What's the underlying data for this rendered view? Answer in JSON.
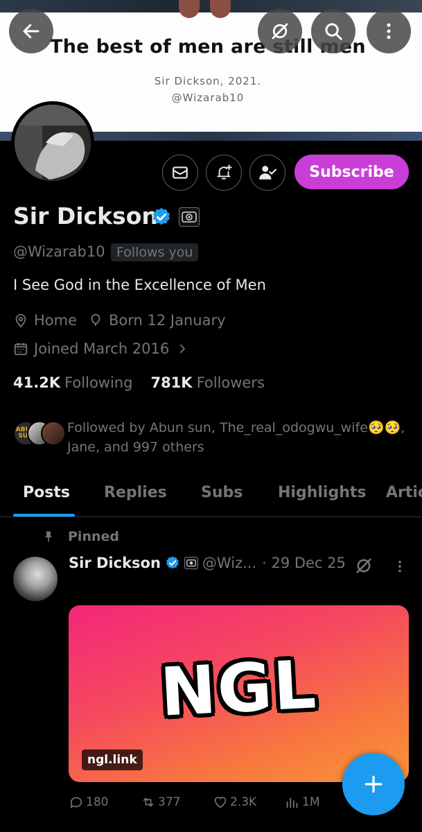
{
  "banner": {
    "quote": "The best of men are still men",
    "signature_line1": "Sir Dickson, 2021.",
    "signature_line2": "@Wizarab10"
  },
  "top_bar": {
    "icons": [
      "arrow-left-icon",
      "grok-icon",
      "search-icon",
      "more-vertical-icon"
    ]
  },
  "actions": {
    "message_icon": "mail-icon",
    "notify_icon": "bell-plus-icon",
    "following_icon": "person-check-icon",
    "subscribe_label": "Subscribe"
  },
  "profile": {
    "name": "Sir Dickson",
    "handle": "@Wizarab10",
    "follows_you": "Follows you",
    "bio": "I See God in the Excellence of Men",
    "location": "Home",
    "birthday": "Born 12 January",
    "joined": "Joined March 2016",
    "following_count": "41.2K",
    "following_label": "Following",
    "followers_count": "781K",
    "followers_label": "Followers",
    "followed_by_line1": "Followed by Abun sun, The_real_odogwu_wife🥺🥺,",
    "followed_by_line2": "Jane, and 997 others",
    "followed_by_avatar_label": "ABUN SUN"
  },
  "tabs": [
    {
      "label": "Posts",
      "active": true
    },
    {
      "label": "Replies",
      "active": false
    },
    {
      "label": "Subs",
      "active": false
    },
    {
      "label": "Highlights",
      "active": false
    },
    {
      "label": "Artic",
      "active": false
    }
  ],
  "post": {
    "pinned_label": "Pinned",
    "author": "Sir Dickson",
    "handle": "@Wiz...",
    "date": "· 29 Dec 25",
    "card_logo": "NGL",
    "card_link": "ngl.link",
    "replies": "180",
    "reposts": "377",
    "likes": "2.3K",
    "views": "1M"
  },
  "colors": {
    "accent": "#1d9bf0",
    "subscribe": "#c93ed6",
    "muted": "#71767b",
    "text": "#e7e9ea",
    "background": "#000000"
  }
}
